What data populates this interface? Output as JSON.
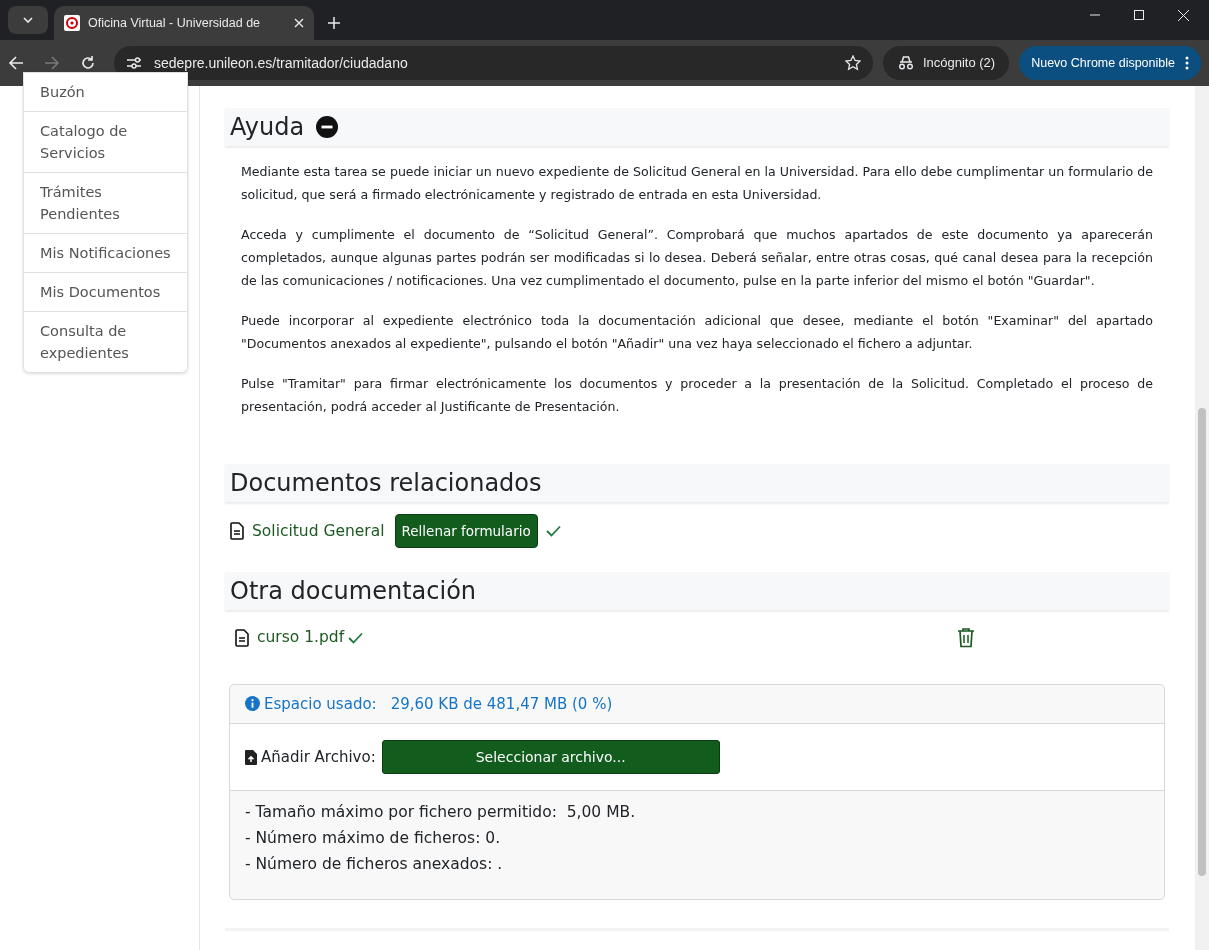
{
  "browser": {
    "tab_title": "Oficina Virtual - Universidad de",
    "url": "sedepre.unileon.es/tramitador/ciudadano",
    "incognito": "Incógnito (2)",
    "update_button": "Nuevo Chrome disponible"
  },
  "sidebar": {
    "items": [
      {
        "label": "Buzón"
      },
      {
        "label": "Catalogo de Servicios"
      },
      {
        "label": "Trámites Pendientes"
      },
      {
        "label": "Mis Notificaciones"
      },
      {
        "label": "Mis Documentos"
      },
      {
        "label": "Consulta de expedientes"
      }
    ]
  },
  "help": {
    "title": "Ayuda",
    "expanded": true,
    "paragraphs": [
      "Mediante esta tarea se puede iniciar un nuevo expediente de Solicitud General en la Universidad. Para ello debe cumplimentar un formulario de solicitud, que será a firmado electrónicamente y registrado de entrada en esta Universidad.",
      "Acceda y cumplimente el documento de “Solicitud General”. Comprobará que muchos apartados de este documento ya aparecerán completados, aunque algunas partes podrán ser modificadas si lo desea. Deberá señalar, entre otras cosas, qué canal desea para la recepción de las comunicaciones / notificaciones. Una vez cumplimentado el documento, pulse en la parte inferior del mismo el botón \"Guardar\".",
      "Puede incorporar al expediente electrónico toda la documentación adicional que desee, mediante el botón \"Examinar\" del apartado \"Documentos anexados al expediente\", pulsando el botón \"Añadir\" una vez haya seleccionado el fichero a adjuntar.",
      "Pulse \"Tramitar\" para firmar electrónicamente los documentos y proceder a la presentación de la Solicitud. Completado el proceso de presentación, podrá acceder al Justificante de Presentación."
    ]
  },
  "related": {
    "title": "Documentos relacionados",
    "documents": [
      {
        "name": "Solicitud General",
        "button": "Rellenar formulario",
        "completed": true
      }
    ]
  },
  "other": {
    "title": "Otra documentación",
    "files": [
      {
        "name": "curso 1.pdf",
        "uploaded": true
      }
    ]
  },
  "upload": {
    "space_label": "Espacio usado:",
    "space_value": "29,60 KB de 481,47 MB (0 %)",
    "add_label": "Añadir Archivo:",
    "select_button": "Seleccionar archivo...",
    "notes": [
      "- Tamaño máximo por fichero permitido:  5,00 MB.",
      "- Número máximo de ficheros: 0.",
      "- Número de ficheros anexados: ."
    ]
  }
}
